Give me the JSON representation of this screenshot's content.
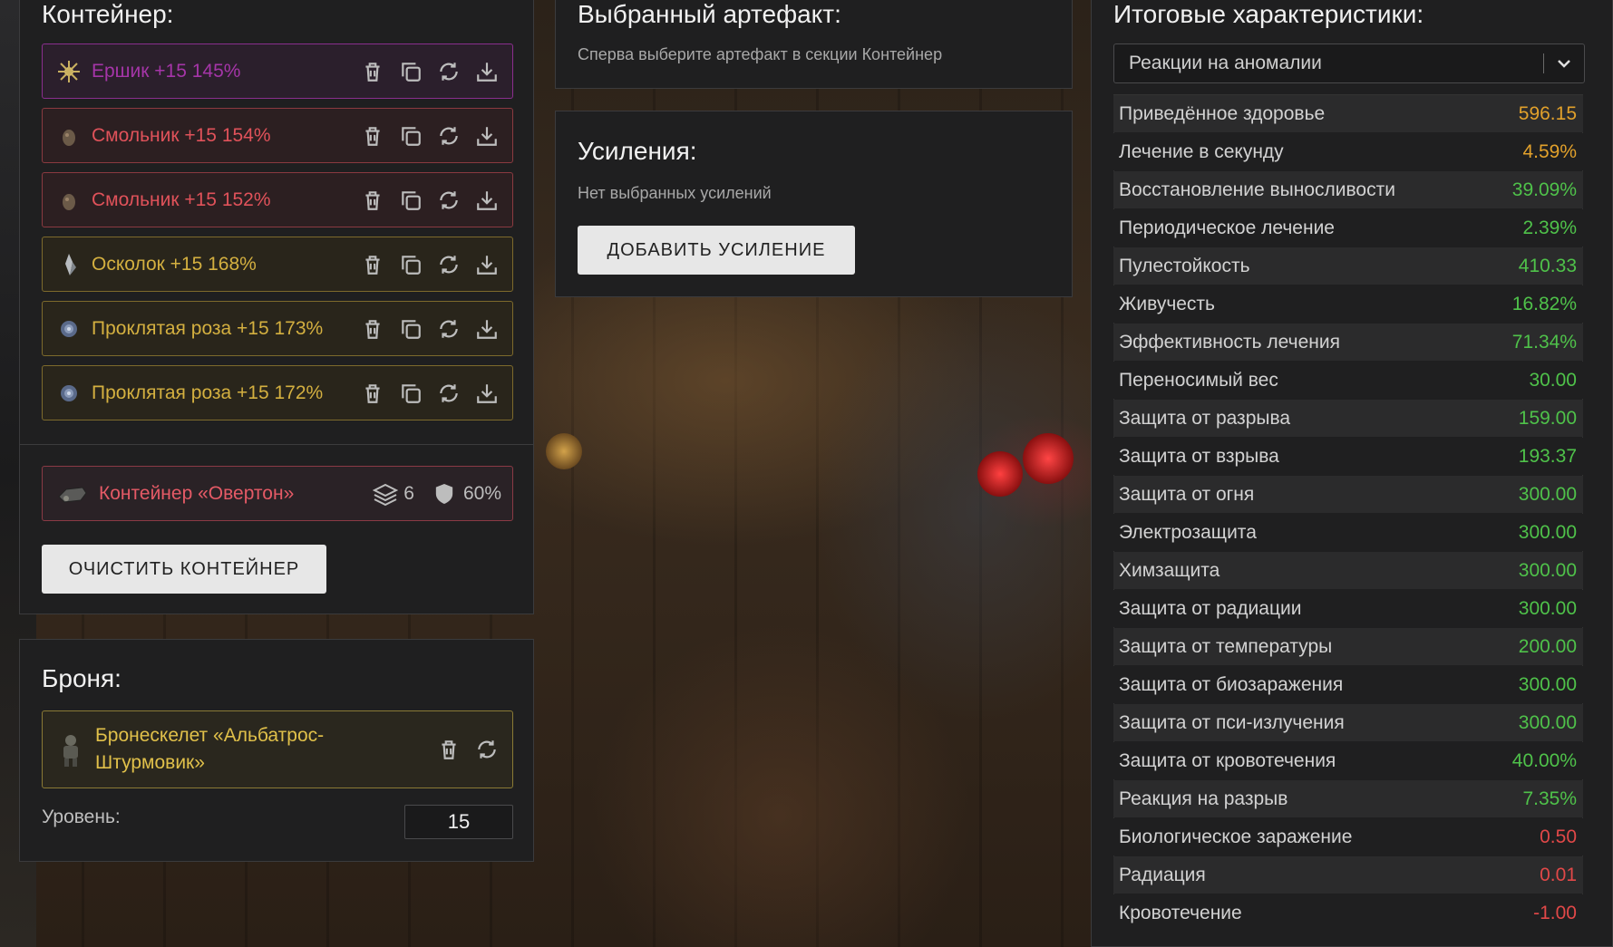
{
  "colors": {
    "purple": "#a535a8",
    "red": "#e0525a",
    "gold": "#d4b040",
    "green": "#4fc24a",
    "orange": "#e2a12b",
    "bad": "#e14848"
  },
  "container_panel": {
    "title": "Контейнер:",
    "artifacts": [
      {
        "name": "Ершик +15 145%",
        "rarity": "purple",
        "icon": "sea-urchin-icon"
      },
      {
        "name": "Смольник +15 154%",
        "rarity": "red",
        "icon": "resin-icon"
      },
      {
        "name": "Смольник +15 152%",
        "rarity": "red",
        "icon": "resin-icon"
      },
      {
        "name": "Осколок +15 168%",
        "rarity": "gold",
        "icon": "shard-icon"
      },
      {
        "name": "Проклятая роза +15 173%",
        "rarity": "gold",
        "icon": "rose-icon"
      },
      {
        "name": "Проклятая роза +15 172%",
        "rarity": "gold",
        "icon": "rose-icon"
      }
    ],
    "container_item": {
      "name": "Контейнер «Овертон»",
      "slots": "6",
      "protection": "60%"
    },
    "clear_button": "ОЧИСТИТЬ КОНТЕЙНЕР"
  },
  "armor_panel": {
    "title": "Броня:",
    "armor_name_line1": "Бронескелет «Альбатрос-",
    "armor_name_line2": "Штурмовик»",
    "level_label": "Уровень:",
    "level_value": "15"
  },
  "selected_panel": {
    "title": "Выбранный артефакт:",
    "hint": "Сперва выберите артефакт в секции Контейнер"
  },
  "boosts_panel": {
    "title": "Усиления:",
    "empty_text": "Нет выбранных усилений",
    "add_button": "ДОБАВИТЬ УСИЛЕНИЕ"
  },
  "summary_panel": {
    "title": "Итоговые характеристики:",
    "filter_selected": "Реакции на аномалии",
    "stats": [
      {
        "label": "Приведённое здоровье",
        "value": "596.15",
        "tone": "orange"
      },
      {
        "label": "Лечение в секунду",
        "value": "4.59%",
        "tone": "orange"
      },
      {
        "label": "Восстановление выносливости",
        "value": "39.09%",
        "tone": "green"
      },
      {
        "label": "Периодическое лечение",
        "value": "2.39%",
        "tone": "green"
      },
      {
        "label": "Пулестойкость",
        "value": "410.33",
        "tone": "green"
      },
      {
        "label": "Живучесть",
        "value": "16.82%",
        "tone": "green"
      },
      {
        "label": "Эффективность лечения",
        "value": "71.34%",
        "tone": "green"
      },
      {
        "label": "Переносимый вес",
        "value": "30.00",
        "tone": "green"
      },
      {
        "label": "Защита от разрыва",
        "value": "159.00",
        "tone": "green"
      },
      {
        "label": "Защита от взрыва",
        "value": "193.37",
        "tone": "green"
      },
      {
        "label": "Защита от огня",
        "value": "300.00",
        "tone": "green"
      },
      {
        "label": "Электрозащита",
        "value": "300.00",
        "tone": "green"
      },
      {
        "label": "Химзащита",
        "value": "300.00",
        "tone": "green"
      },
      {
        "label": "Защита от радиации",
        "value": "300.00",
        "tone": "green"
      },
      {
        "label": "Защита от температуры",
        "value": "200.00",
        "tone": "green"
      },
      {
        "label": "Защита от биозаражения",
        "value": "300.00",
        "tone": "green"
      },
      {
        "label": "Защита от пси-излучения",
        "value": "300.00",
        "tone": "green"
      },
      {
        "label": "Защита от кровотечения",
        "value": "40.00%",
        "tone": "green"
      },
      {
        "label": "Реакция на разрыв",
        "value": "7.35%",
        "tone": "green"
      },
      {
        "label": "Биологическое заражение",
        "value": "0.50",
        "tone": "bad"
      },
      {
        "label": "Радиация",
        "value": "0.01",
        "tone": "bad"
      },
      {
        "label": "Кровотечение",
        "value": "-1.00",
        "tone": "bad"
      }
    ]
  }
}
